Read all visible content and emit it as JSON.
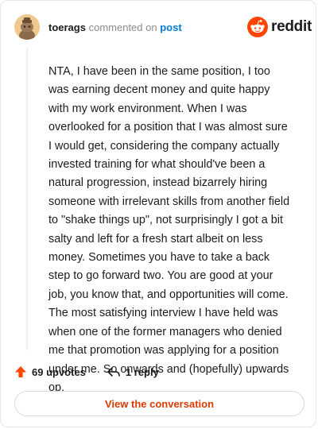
{
  "header": {
    "username": "toerags",
    "commented_on": "commented on",
    "post_link": "post"
  },
  "brand": {
    "wordmark": "reddit",
    "accent": "#ff4500"
  },
  "comment": {
    "body": "NTA, I have been in the same position, I too was earning decent money and quite happy with my work environment. When I was overlooked for a position that I was almost sure I would get, considering the company actually invested training for what should've been a natural progression, instead bizarrely hiring someone with irrelevant skills from another field to \"shake things up\", not surprisingly I got a bit salty and left for a fresh start albeit on less money. Sometimes you have to take a back step to go forward two. You are good at your job, you know that, and opportunities will come. The most satisfying interview I have held was when one of the former managers who denied me that promotion was applying for a position under me. So onwards and (hopefully) upwards op."
  },
  "actions": {
    "upvotes": "69 upvotes",
    "replies": "1 reply"
  },
  "cta": {
    "label": "View the conversation",
    "color": "#d93a00"
  }
}
